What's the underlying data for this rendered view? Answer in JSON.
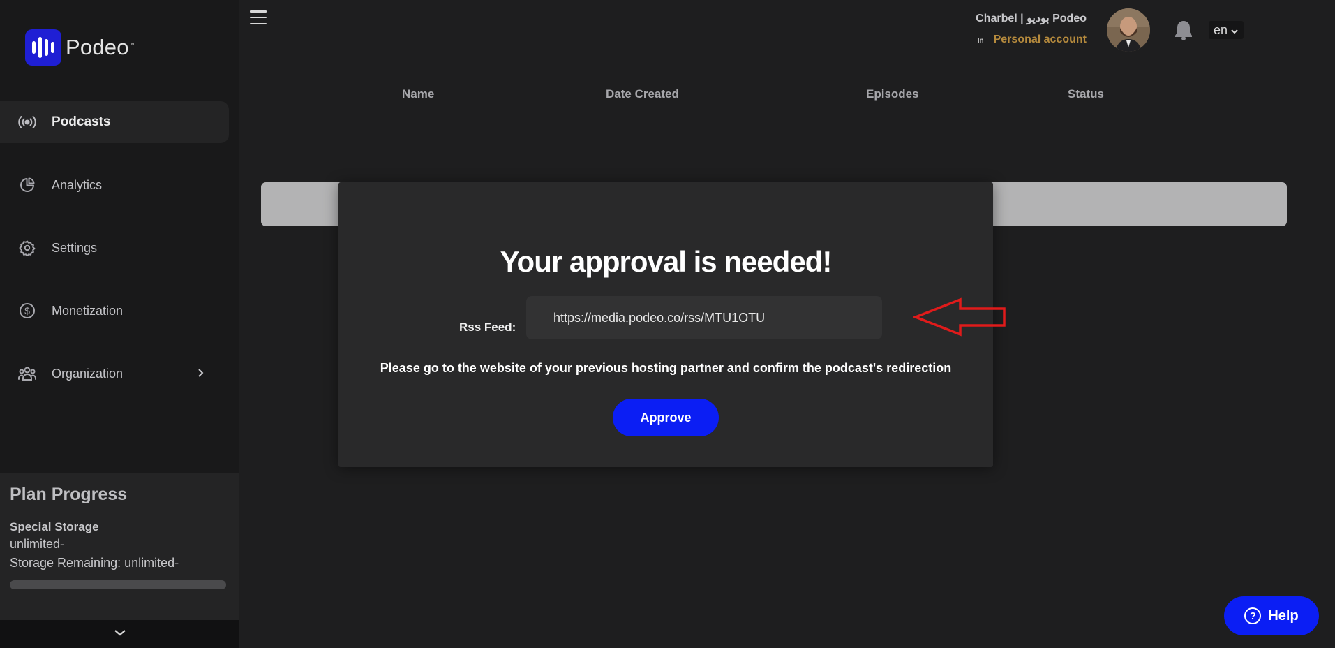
{
  "brand": {
    "logo_text": "Podeo",
    "logo_tm": "™",
    "accent": "#0b1ef4"
  },
  "sidebar": {
    "items": [
      {
        "label": "Podcasts",
        "icon": "broadcast-icon",
        "active": true
      },
      {
        "label": "Analytics",
        "icon": "pie-chart-icon"
      },
      {
        "label": "Settings",
        "icon": "gear-icon"
      },
      {
        "label": "Monetization",
        "icon": "dollar-coin-icon"
      },
      {
        "label": "Organization",
        "icon": "group-icon",
        "has_submenu": true
      }
    ],
    "plan": {
      "title": "Plan Progress",
      "storage_title": "Special Storage",
      "storage_value": "unlimited-",
      "remaining": "Storage Remaining: unlimited-",
      "progress": 0
    }
  },
  "header": {
    "user_name": "Charbel | بوديو Podeo",
    "account_prefix": "In",
    "account_type": "Personal account",
    "account_type_color": "#b58a3d",
    "language": "en"
  },
  "table": {
    "columns": [
      "Name",
      "Date Created",
      "Episodes",
      "Status"
    ]
  },
  "modal": {
    "title": "Your approval is needed!",
    "rss_label": "Rss Feed:",
    "rss_value": "https://media.podeo.co/rss/MTU1OTU",
    "message": "Please go to the website of your previous hosting partner and confirm the podcast's redirection",
    "approve_label": "Approve"
  },
  "help": {
    "label": "Help"
  }
}
